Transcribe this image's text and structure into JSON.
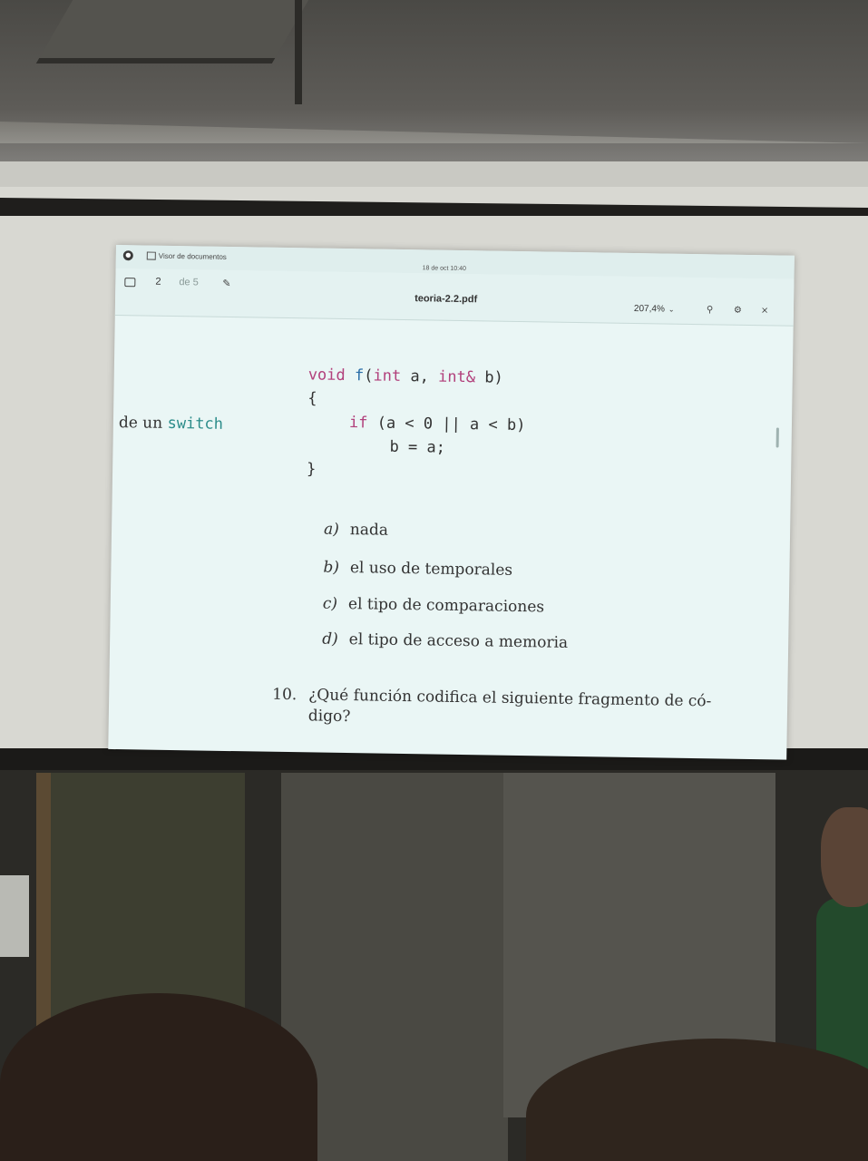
{
  "window": {
    "app_name": "Visor de documentos",
    "clock": "18 de oct  10:40",
    "doc_title": "teoria-2.2.pdf"
  },
  "toolbar": {
    "page_current": "2",
    "page_of": "de 5",
    "zoom": "207,4%",
    "icons": [
      "sidebar-icon",
      "annotate-icon",
      "search-icon",
      "menu-icon",
      "close-icon"
    ]
  },
  "page": {
    "side_text_prefix": "de un",
    "side_text_code": "switch",
    "code": {
      "line1_kw1": "void",
      "line1_fn": "f",
      "line1_rest1": "(",
      "line1_kw2": "int",
      "line1_rest2": " a, ",
      "line1_kw3": "int&",
      "line1_rest3": " b)",
      "line2": "{",
      "line3_kw": "if",
      "line3_rest": " (a < 0 || a < b)",
      "line4": "b = a;",
      "line5": "}"
    },
    "answers": [
      {
        "letter": "a)",
        "text": "nada"
      },
      {
        "letter": "b)",
        "text": "el uso de temporales"
      },
      {
        "letter": "c)",
        "text": "el tipo de comparaciones"
      },
      {
        "letter": "d)",
        "text": "el tipo de acceso a memoria"
      }
    ],
    "question": {
      "number": "10.",
      "line1": "¿Qué función codifica el siguiente fragmento de có-",
      "line2": "digo?"
    }
  }
}
